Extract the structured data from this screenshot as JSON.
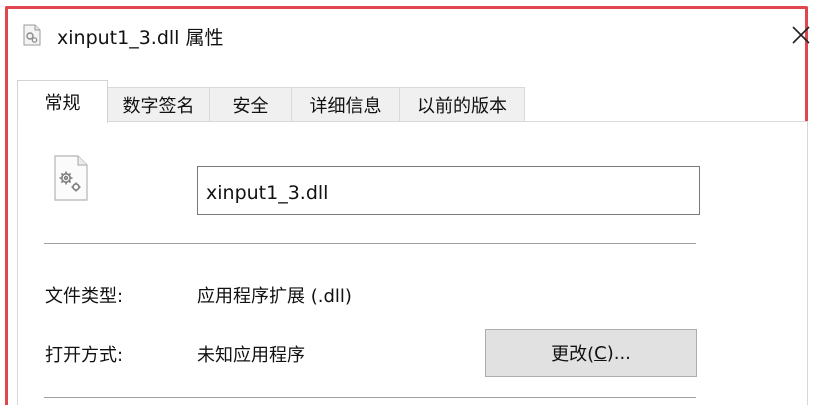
{
  "window": {
    "title": "xinput1_3.dll 属性",
    "title_icon": "dll-file-icon",
    "close_glyph": "✕"
  },
  "tabs": [
    {
      "label": "常规",
      "active": true
    },
    {
      "label": "数字签名",
      "active": false
    },
    {
      "label": "安全",
      "active": false
    },
    {
      "label": "详细信息",
      "active": false
    },
    {
      "label": "以前的版本",
      "active": false
    }
  ],
  "general": {
    "file_icon": "dll-gear-file-icon",
    "file_name": "xinput1_3.dll",
    "file_type_label": "文件类型:",
    "file_type_value": "应用程序扩展 (.dll)",
    "open_with_label": "打开方式:",
    "open_with_value": "未知应用程序",
    "change_button": {
      "prefix": "更改(",
      "mnemonic": "C",
      "suffix": ")..."
    }
  },
  "colors": {
    "highlight_frame": "#e0464e",
    "button_face": "#e1e1e1",
    "tab_inactive": "#f0f0f0"
  }
}
